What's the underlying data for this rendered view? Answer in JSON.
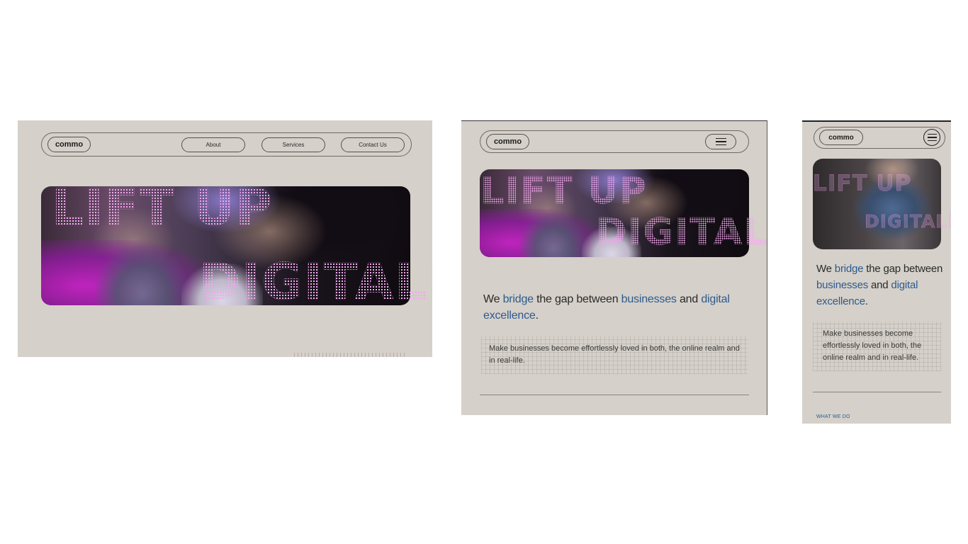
{
  "brand": {
    "logo": "commo"
  },
  "nav": {
    "about": "About",
    "services": "Services",
    "contact": "Contact Us"
  },
  "hero": {
    "line1": "LIFT UP",
    "line2": "DIGITALLY"
  },
  "headline": {
    "w1": "We ",
    "w2": "bridge",
    "w3": " the gap between ",
    "w4": "businesses",
    "w5": " and ",
    "w6": "digital excellence",
    "w7": "."
  },
  "body": {
    "text": "Make businesses become effortlessly loved in both, the online realm and in real-life."
  },
  "section": {
    "what_we_do": "WHAT WE DO"
  },
  "icons": {
    "menu": "hamburger-menu-icon"
  },
  "colors": {
    "background": "#d5d0c9",
    "accent": "#2d5b8f",
    "dots": "#f2a8ee"
  }
}
